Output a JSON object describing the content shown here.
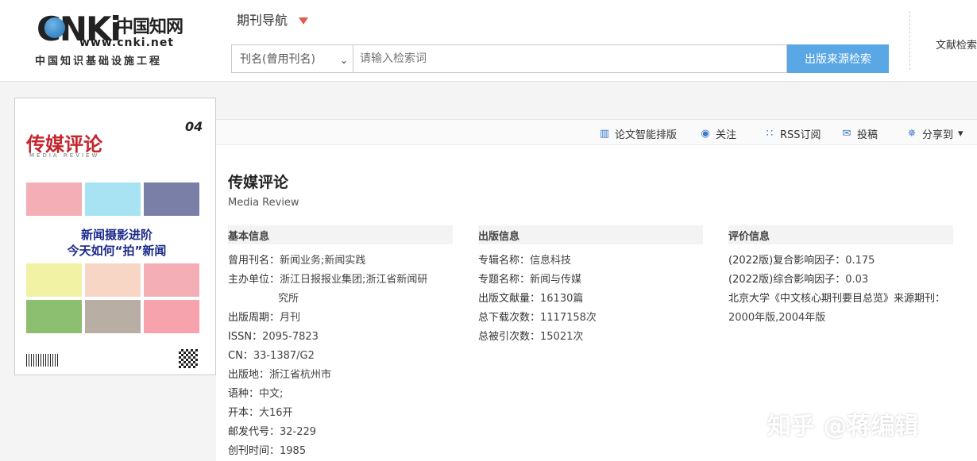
{
  "header": {
    "logo": {
      "brand": "CNKi",
      "cn_name": "中国知网",
      "url": "www.cnki.net",
      "subtitle": "中国知识基础设施工程"
    },
    "journal_nav": "期刊导航",
    "search": {
      "field_selected": "刊名(曾用刊名)",
      "placeholder": "请输入检索词",
      "button": "出版来源检索"
    },
    "literature_search": "文献检索"
  },
  "cover": {
    "title": "传媒评论",
    "subtitle": "MEDIA REVIEW",
    "issue": "04",
    "headline_1": "新闻摄影进阶",
    "headline_2": "今天如何“拍”新闻"
  },
  "toolbar": {
    "layout": "论文智能排版",
    "follow": "关注",
    "rss": "RSS订阅",
    "submit": "投稿",
    "share": "分享到"
  },
  "journal": {
    "title": "传媒评论",
    "english": "Media Review"
  },
  "basic_info": {
    "heading": "基本信息",
    "rows": [
      {
        "label": "曾用刊名：",
        "value": "新闻业务;新闻实践"
      },
      {
        "label": "主办单位：",
        "value": "浙江日报报业集团;浙江省新闻研"
      },
      {
        "label": "",
        "value": "究所"
      },
      {
        "label": "出版周期：",
        "value": "月刊"
      },
      {
        "label": "ISSN：",
        "value": "2095-7823"
      },
      {
        "label": "CN：",
        "value": "33-1387/G2"
      },
      {
        "label": "出版地：",
        "value": "浙江省杭州市"
      },
      {
        "label": "语种：",
        "value": "中文;"
      },
      {
        "label": "开本：",
        "value": "大16开"
      },
      {
        "label": "邮发代号：",
        "value": "32-229"
      },
      {
        "label": "创刊时间：",
        "value": "1985"
      }
    ]
  },
  "publish_info": {
    "heading": "出版信息",
    "rows": [
      {
        "label": "专辑名称：",
        "value": "信息科技"
      },
      {
        "label": "专题名称：",
        "value": "新闻与传媒"
      },
      {
        "label": "出版文献量：",
        "value": "16130篇"
      },
      {
        "label": "总下载次数：",
        "value": "1117158次"
      },
      {
        "label": "总被引次数：",
        "value": "15021次"
      }
    ]
  },
  "eval_info": {
    "heading": "评价信息",
    "rows": [
      {
        "label": "(2022版)复合影响因子：",
        "value": "0.175"
      },
      {
        "label": "(2022版)综合影响因子：",
        "value": "0.03"
      },
      {
        "label": "北京大学《中文核心期刊要目总览》来源期刊：",
        "value": ""
      },
      {
        "label": "",
        "value": "2000年版,2004年版"
      }
    ]
  },
  "watermark": "知乎 @蒋编辑",
  "colors": {
    "accent": "#5aa7e6",
    "cover_title": "#c3262d",
    "nav_triangle": "#e25b4b"
  }
}
